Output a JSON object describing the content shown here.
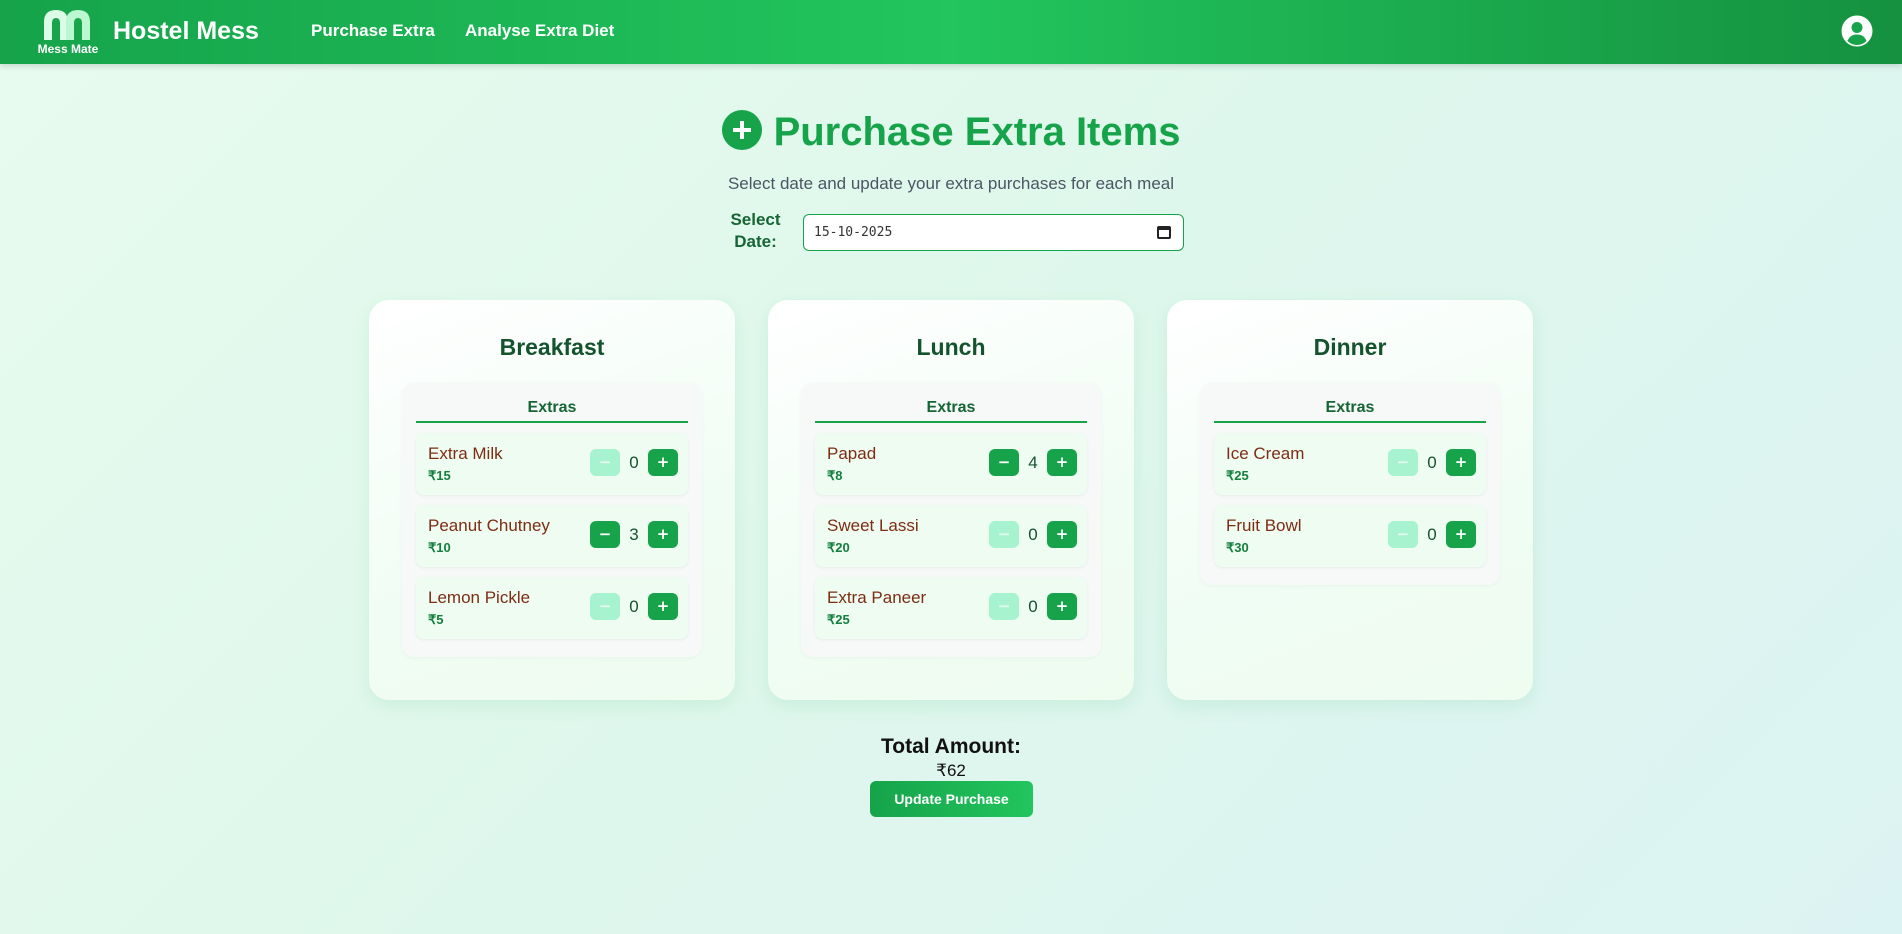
{
  "navbar": {
    "logo_text": "Mess Mate",
    "brand": "Hostel Mess",
    "links": [
      "Purchase Extra",
      "Analyse Extra Diet"
    ]
  },
  "header": {
    "title": "Purchase Extra Items",
    "subtitle": "Select date and update your extra purchases for each meal",
    "date_label": "Select Date:",
    "date_value": "15-10-2025"
  },
  "meals": [
    {
      "title": "Breakfast",
      "extras_heading": "Extras",
      "items": [
        {
          "name": "Extra Milk",
          "price": "₹15",
          "qty": "0"
        },
        {
          "name": "Peanut Chutney",
          "price": "₹10",
          "qty": "3"
        },
        {
          "name": "Lemon Pickle",
          "price": "₹5",
          "qty": "0"
        }
      ]
    },
    {
      "title": "Lunch",
      "extras_heading": "Extras",
      "items": [
        {
          "name": "Papad",
          "price": "₹8",
          "qty": "4"
        },
        {
          "name": "Sweet Lassi",
          "price": "₹20",
          "qty": "0"
        },
        {
          "name": "Extra Paneer",
          "price": "₹25",
          "qty": "0"
        }
      ]
    },
    {
      "title": "Dinner",
      "extras_heading": "Extras",
      "items": [
        {
          "name": "Ice Cream",
          "price": "₹25",
          "qty": "0"
        },
        {
          "name": "Fruit Bowl",
          "price": "₹30",
          "qty": "0"
        }
      ]
    }
  ],
  "buttons": {
    "minus": "−",
    "plus": "+"
  },
  "total": {
    "label": "Total Amount:",
    "value": "₹62"
  },
  "update_button": "Update Purchase",
  "colors": {
    "accent": "#16a34a",
    "disabled": "#a7f3d0"
  },
  "icons": {
    "logo": "mess-mate-logo",
    "user": "user-circle-icon",
    "title": "plus-circle-icon",
    "date": "calendar-icon"
  }
}
